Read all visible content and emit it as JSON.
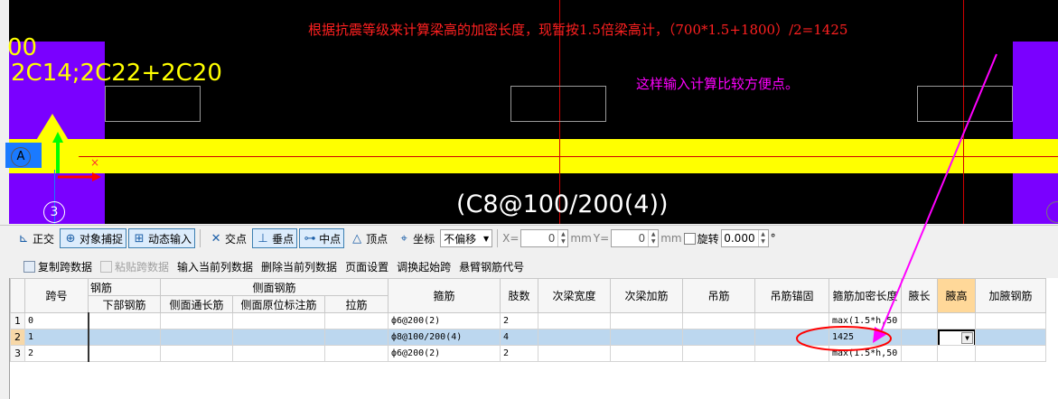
{
  "canvas": {
    "annotation_red": "根据抗震等级来计算梁高的加密长度，现暂按1.5倍梁高计，（700*1.5+1800）/2=1425",
    "annotation_magenta": "这样输入计算比较方便点。",
    "left_label_top": "00",
    "left_label_rebar": "2C14;2C22+2C20",
    "stirrup_label": "(C8@100/200(4))",
    "axis_a": "A",
    "axis_3": "3"
  },
  "snap_toolbar": {
    "orthogonal": "正交",
    "object_snap": "对象捕捉",
    "dynamic_input": "动态输入",
    "intersection": "交点",
    "perpendicular": "垂点",
    "midpoint": "中点",
    "vertex": "顶点",
    "coordinate": "坐标",
    "offset_select": "不偏移",
    "x_label": "X=",
    "x_value": "0",
    "y_label": "Y=",
    "y_value": "0",
    "unit_mm": "mm",
    "rotate_label": "旋转",
    "rotate_value": "0.000",
    "degree": "°"
  },
  "table_toolbar": {
    "copy_span": "复制跨数据",
    "paste_span": "粘贴跨数据",
    "input_column": "输入当前列数据",
    "delete_column": "删除当前列数据",
    "page_setup": "页面设置",
    "swap_start": "调换起始跨",
    "cantilever_code": "悬臂钢筋代号"
  },
  "grid": {
    "headers_top": {
      "span_no": "跨号",
      "rebar_group": "钢筋",
      "side_group": "侧面钢筋",
      "stirrup": "箍筋",
      "legs": "肢数",
      "secondary_width": "次梁宽度",
      "secondary_add": "次梁加筋",
      "hanger": "吊筋",
      "hanger_anchor": "吊筋锚固",
      "densify_length": "箍筋加密长度",
      "haunch_length": "腋长",
      "haunch_height": "腋高",
      "haunch_rebar": "加腋钢筋"
    },
    "headers_sub": {
      "bottom_rebar": "下部钢筋",
      "side_through": "侧面通长筋",
      "side_in_situ": "侧面原位标注筋",
      "tie": "拉筋"
    },
    "rows": [
      {
        "idx": "1",
        "span": "0",
        "stirrup": "ф6@200(2)",
        "legs": "2",
        "densify": "max(1.5*h,50"
      },
      {
        "idx": "2",
        "span": "1",
        "stirrup": "ф8@100/200(4)",
        "legs": "4",
        "densify": "1425"
      },
      {
        "idx": "3",
        "span": "2",
        "stirrup": "ф6@200(2)",
        "legs": "2",
        "densify": "max(1.5*h,50"
      }
    ]
  }
}
